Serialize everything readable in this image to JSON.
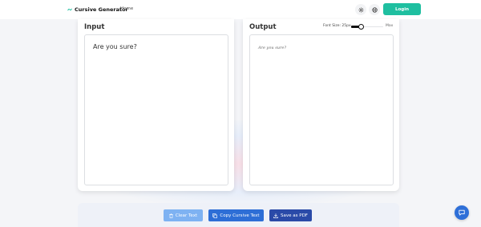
{
  "header": {
    "brand": "Cursive Generator",
    "nav_home": "Home",
    "theme_icon": "sun-icon",
    "language_icon": "globe-icon",
    "login_label": "Login",
    "accent_color": "#1fbfa0"
  },
  "input_panel": {
    "title": "Input",
    "text": "Are you sure?"
  },
  "output_panel": {
    "title": "Output",
    "font_size_label": "Font Size: 25px",
    "font_size_value_px": 25,
    "font_size_max_label": "Max",
    "slider_fraction": 0.3,
    "text": "Are you sure?"
  },
  "actions": {
    "clear_label": "Clear Text",
    "copy_label": "Copy Cursive Text",
    "pdf_label": "Save as PDF",
    "clear_icon": "trash-icon",
    "copy_icon": "copy-icon",
    "pdf_icon": "download-icon"
  },
  "chat": {
    "icon": "chat-icon"
  }
}
